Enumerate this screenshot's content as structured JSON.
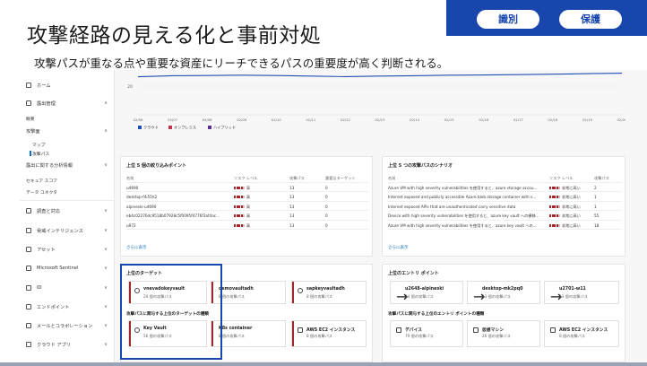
{
  "slide": {
    "title": "攻撃経路の見える化と事前対処",
    "subtitle": "攻撃パスが重なる点や重要な資産にリーチできるパスの重要度が高く判断される。",
    "buttons": [
      "識別",
      "保護"
    ],
    "accent_color": "#1846ad"
  },
  "sidebar": {
    "items": [
      {
        "label": "ホーム",
        "icon": "home-icon"
      },
      {
        "label": "露出管理",
        "icon": "shield-icon"
      },
      {
        "label": "概要",
        "icon": ""
      },
      {
        "label": "攻撃面",
        "icon": ""
      },
      {
        "label": "マップ",
        "icon": ""
      },
      {
        "label": "攻撃パス",
        "icon": ""
      },
      {
        "label": "露出に関する分析情報",
        "icon": ""
      },
      {
        "label": "セキュア スコア",
        "icon": ""
      },
      {
        "label": "データ コネクタ",
        "icon": ""
      },
      {
        "label": "調査と対応",
        "icon": "investigate-icon"
      },
      {
        "label": "脅威インテリジェンス",
        "icon": "intel-icon"
      },
      {
        "label": "アセット",
        "icon": "assets-icon"
      },
      {
        "label": "Microsoft Sentinel",
        "icon": "sentinel-icon"
      },
      {
        "label": "ID",
        "icon": "identity-icon"
      },
      {
        "label": "エンドポイント",
        "icon": "endpoint-icon"
      },
      {
        "label": "メールとコラボレーション",
        "icon": "mail-icon"
      },
      {
        "label": "クラウド アプリ",
        "icon": "cloud-icon"
      }
    ]
  },
  "chart_data": {
    "type": "line",
    "x": [
      "02/06",
      "02/07",
      "02/08",
      "02/09",
      "02/10",
      "02/11",
      "02/12",
      "02/13",
      "02/14",
      "02/15",
      "02/16",
      "02/17",
      "02/18",
      "02/19",
      "02/20"
    ],
    "series": [
      {
        "name": "クラウド",
        "color": "#1f4fb4",
        "values": [
          26.5,
          27.2,
          27.4,
          27.6,
          27.4,
          27.0,
          26.6,
          27.0,
          27.2,
          27.6,
          27.8,
          28.0,
          28.3,
          28.7,
          29.0
        ]
      },
      {
        "name": "オンプレミス",
        "color": "#c4314b",
        "values": []
      },
      {
        "name": "ハイブリッド",
        "color": "#5c2e91",
        "values": []
      }
    ],
    "ylabel_tick": "20",
    "ylim": [
      0,
      30
    ],
    "legend_position": "bottom-left"
  },
  "chokepoints": {
    "title": "上位 5 個の絞り込みポイント",
    "headers": [
      "名前",
      "リスク レベル",
      "攻撃パス",
      "重要なターゲット"
    ],
    "rows": [
      {
        "name": "u4690",
        "risk": "高",
        "paths": "13",
        "targets": "0"
      },
      {
        "name": "desktop-f4i55h2",
        "risk": "高",
        "paths": "13",
        "targets": "0"
      },
      {
        "name": "alpineski-u4690",
        "risk": "高",
        "paths": "13",
        "targets": "0"
      },
      {
        "name": "eb4c02276dc9518b07928c5f0095f4776f3af4ac...",
        "risk": "高",
        "paths": "13",
        "targets": "0"
      },
      {
        "name": "u972",
        "risk": "高",
        "paths": "13",
        "targets": "0"
      }
    ],
    "more": "さらに表示"
  },
  "scenarios": {
    "title": "上位 5 つの攻撃パスのシナリオ",
    "headers": [
      "名前",
      "リスク レベル",
      "攻撃パス"
    ],
    "rows": [
      {
        "name": "Azure VM with high severity vulnerabilities を使用すると、azure storage accou...",
        "risk": "非常に高い",
        "paths": "2"
      },
      {
        "name": "Internet exposed and publicly accessible Azure blob storage container with s...",
        "risk": "非常に高い",
        "paths": "1"
      },
      {
        "name": "Internet exposed APIs that are unauthenticated carry sensitive data",
        "risk": "非常に高い",
        "paths": "1"
      },
      {
        "name": "Device with high severity vulnerabilities を使用すると、azure key vault への横移...",
        "risk": "非常に高い",
        "paths": "55"
      },
      {
        "name": "Azure VM with high severity vulnerabilities を使用すると、azure key vault への...",
        "risk": "非常に高い",
        "paths": "18"
      }
    ],
    "more": "さらに表示"
  },
  "top_targets": {
    "title": "上位のターゲット",
    "tiles": [
      {
        "name": "vnevadokeyvault",
        "count": "20 個の攻撃パス"
      },
      {
        "name": "demovaultadh",
        "count": "8 個の攻撃パス"
      },
      {
        "name": "sapkeyvaultadh",
        "count": "8 個の攻撃パス"
      }
    ],
    "types_label": "攻撃パスに関与する上位のターゲットの種類",
    "types": [
      {
        "name": "Key Vault",
        "count": "56 個の攻撃パス"
      },
      {
        "name": "K8s container",
        "count": "8 個の攻撃パス"
      },
      {
        "name": "AWS EC2 インスタンス",
        "count": "8 個の攻撃パス"
      }
    ]
  },
  "top_entry": {
    "title": "上位のエントリ ポイント",
    "tiles": [
      {
        "name": "u2648-alpineski",
        "count": "14 個の攻撃パス"
      },
      {
        "name": "desktop-mk2pq0",
        "count": "13 個の攻撃パス"
      },
      {
        "name": "u2701-w11",
        "count": "13 個の攻撃パス"
      }
    ],
    "types_label": "攻撃パスに関与する上位のエントリ ポイントの種類",
    "types": [
      {
        "name": "デバイス",
        "count": "79 個の攻撃パス"
      },
      {
        "name": "仮想マシン",
        "count": "26 個の攻撃パス"
      },
      {
        "name": "AWS EC2 インスタンス",
        "count": "8 個の攻撃パス"
      }
    ]
  }
}
